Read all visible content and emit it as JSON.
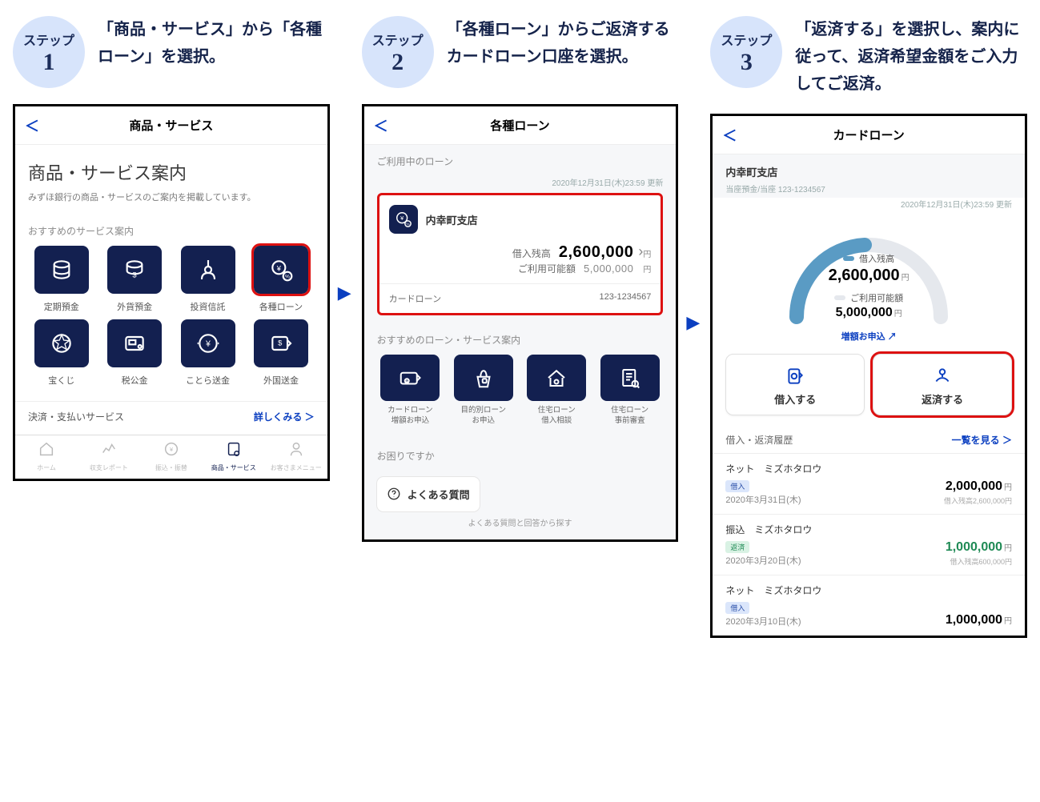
{
  "steps": [
    {
      "badge_label": "ステップ",
      "badge_num": "1",
      "desc": "「商品・サービス」から「各種ローン」を選択。"
    },
    {
      "badge_label": "ステップ",
      "badge_num": "2",
      "desc": "「各種ローン」からご返済するカードローン口座を選択。"
    },
    {
      "badge_label": "ステップ",
      "badge_num": "3",
      "desc": "「返済する」を選択し、案内に従って、返済希望金額をご入力してご返済。"
    }
  ],
  "screen1": {
    "title": "商品・サービス",
    "heading": "商品・サービス案内",
    "sub": "みずほ銀行の商品・サービスのご案内を掲載しています。",
    "rec_head": "おすすめのサービス案内",
    "tiles": [
      "定期預金",
      "外貨預金",
      "投資信託",
      "各種ローン",
      "宝くじ",
      "税公金",
      "ことら送金",
      "外国送金"
    ],
    "row_link_left": "決済・支払いサービス",
    "row_link_right": "詳しくみる ＞",
    "nav": [
      "ホーム",
      "収支レポート",
      "振込・振替",
      "商品・サービス",
      "お客さまメニュー"
    ]
  },
  "screen2": {
    "title": "各種ローン",
    "head1": "ご利用中のローン",
    "update": "2020年12月31日(木)23:59 更新",
    "branch": "内幸町支店",
    "bal_label": "借入残高",
    "bal_value": "2,600,000",
    "avail_label": "ご利用可能額",
    "avail_value": "5,000,000",
    "unit": "円",
    "card_name": "カードローン",
    "acct_no": "123-1234567",
    "rec_head": "おすすめのローン・サービス案内",
    "tiles": [
      "カードローン\n増額お申込",
      "目的別ローン\nお申込",
      "住宅ローン\n借入相談",
      "住宅ローン\n事前審査"
    ],
    "trouble": "お困りですか",
    "faq": "よくある質問",
    "faq_sub": "よくある質問と回答から探す"
  },
  "screen3": {
    "title": "カードローン",
    "branch": "内幸町支店",
    "acct_line": "当座預金/当座 123-1234567",
    "update": "2020年12月31日(木)23:59 更新",
    "bal_label": "借入残高",
    "bal_value": "2,600,000",
    "avail_label": "ご利用可能額",
    "avail_value": "5,000,000",
    "unit": "円",
    "increase": "増額お申込 ↗",
    "borrow_btn": "借入する",
    "repay_btn": "返済する",
    "hist_head": "借入・返済履歴",
    "hist_link": "一覧を見る ＞",
    "history": [
      {
        "ch": "ネット",
        "name": "ミズホタロウ",
        "tag": "借入",
        "tag_class": "tag-borrow",
        "date": "2020年3月31日(木)",
        "amount": "2,000,000",
        "amt_class": "",
        "sub": "借入残高2,600,000円"
      },
      {
        "ch": "振込",
        "name": "ミズホタロウ",
        "tag": "返済",
        "tag_class": "tag-repay",
        "date": "2020年3月20日(木)",
        "amount": "1,000,000",
        "amt_class": "green",
        "sub": "借入残高600,000円"
      },
      {
        "ch": "ネット",
        "name": "ミズホタロウ",
        "tag": "借入",
        "tag_class": "tag-borrow",
        "date": "2020年3月10日(木)",
        "amount": "1,000,000",
        "amt_class": "",
        "sub": ""
      }
    ]
  }
}
